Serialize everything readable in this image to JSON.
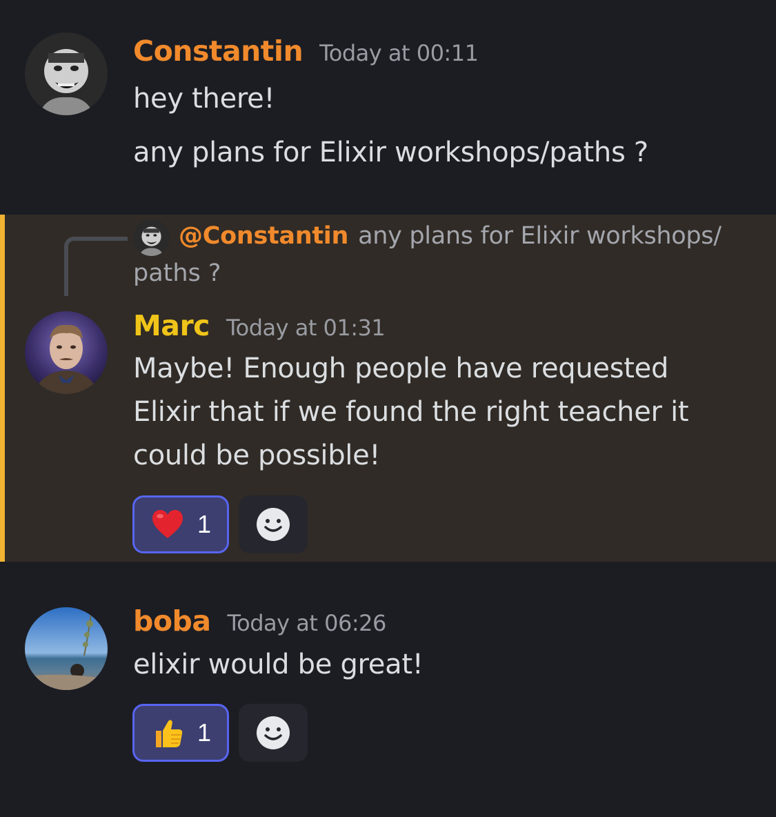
{
  "messages": [
    {
      "author": "Constantin",
      "author_color": "#f18a2c",
      "timestamp": "Today at 00:11",
      "lines": [
        "hey there!",
        "any plans for Elixir workshops/paths ?"
      ]
    },
    {
      "author": "Marc",
      "author_color": "#f0c419",
      "timestamp": "Today at 01:31",
      "highlighted": true,
      "reply": {
        "mention": "@Constantin",
        "snippet_line1": "any plans for Elixir workshops/",
        "snippet_line2": "paths ?"
      },
      "lines": [
        "Maybe! Enough people have requested",
        "Elixir that if we found the right teacher it",
        "could be possible!"
      ],
      "reaction": {
        "emoji": "heart-emoji",
        "count": "1"
      }
    },
    {
      "author": "boba",
      "author_color": "#f18a2c",
      "timestamp": "Today at 06:26",
      "lines": [
        "elixir would be great!"
      ],
      "reaction": {
        "emoji": "thumbs-up-emoji",
        "count": "1"
      }
    }
  ],
  "colors": {
    "background": "#1c1d23",
    "highlight_background": "#302b26",
    "highlight_bar": "#f0b232",
    "reaction_border": "#5865f2",
    "reaction_background": "#3c3f70"
  }
}
